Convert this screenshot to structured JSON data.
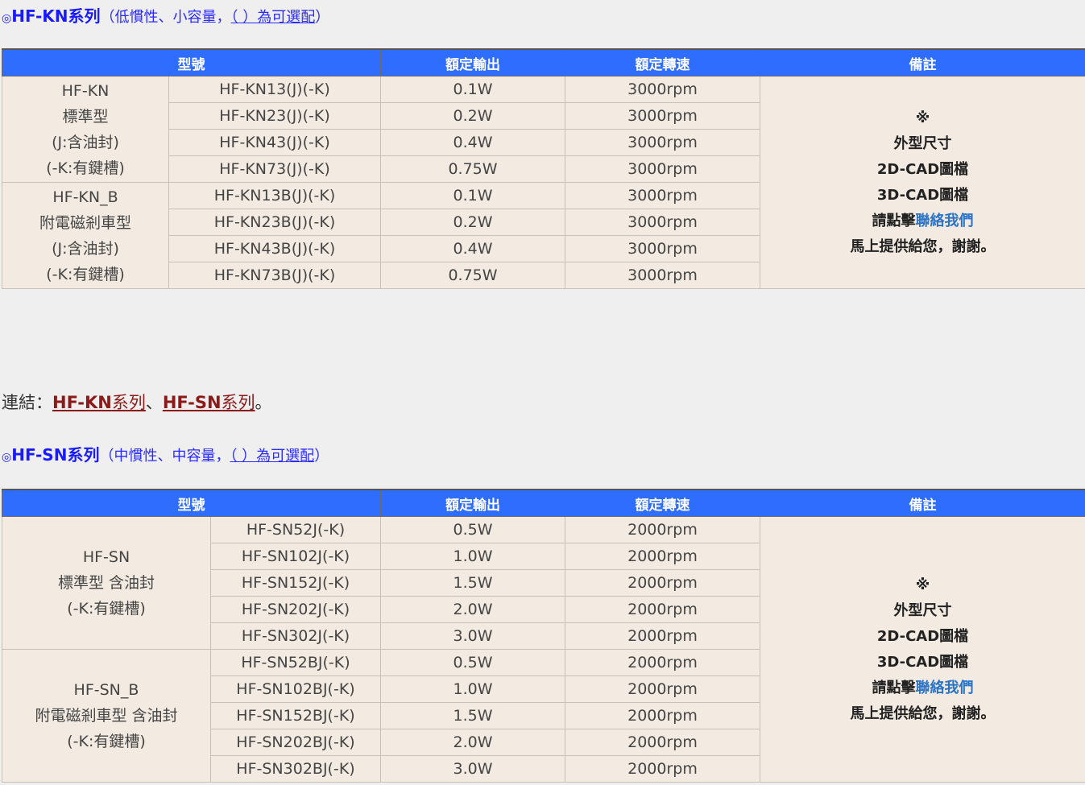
{
  "kn": {
    "heading": {
      "title": "HF-KN系列",
      "subtitle": "（低慣性、小容量，",
      "optional": "（ ）為可選配",
      "close": "）"
    },
    "headers": [
      "型號",
      "額定輸出",
      "額定轉速",
      "備註"
    ],
    "groups": [
      {
        "label_lines": [
          "HF-KN",
          "標準型",
          "(J:含油封)",
          "(-K:有鍵槽)"
        ],
        "rows": [
          {
            "model": "HF-KN13(J)(-K)",
            "output": "0.1W",
            "speed": "3000rpm"
          },
          {
            "model": "HF-KN23(J)(-K)",
            "output": "0.2W",
            "speed": "3000rpm"
          },
          {
            "model": "HF-KN43(J)(-K)",
            "output": "0.4W",
            "speed": "3000rpm"
          },
          {
            "model": "HF-KN73(J)(-K)",
            "output": "0.75W",
            "speed": "3000rpm"
          }
        ]
      },
      {
        "label_lines": [
          "HF-KN_B",
          "附電磁剎車型",
          "(J:含油封)",
          "(-K:有鍵槽)"
        ],
        "rows": [
          {
            "model": "HF-KN13B(J)(-K)",
            "output": "0.1W",
            "speed": "3000rpm"
          },
          {
            "model": "HF-KN23B(J)(-K)",
            "output": "0.2W",
            "speed": "3000rpm"
          },
          {
            "model": "HF-KN43B(J)(-K)",
            "output": "0.4W",
            "speed": "3000rpm"
          },
          {
            "model": "HF-KN73B(J)(-K)",
            "output": "0.75W",
            "speed": "3000rpm"
          }
        ]
      }
    ],
    "note": {
      "mark": "※",
      "line1": "外型尺寸",
      "line2": "2D-CAD圖檔",
      "line3": "3D-CAD圖檔",
      "click": "請點擊",
      "contact": "聯絡我們",
      "thanks": "馬上提供給您，謝謝。"
    }
  },
  "links": {
    "prefix": "連結：",
    "kn_code": "HF-KN",
    "kn_suffix": "系列",
    "sep": "、",
    "sn_code": "HF-SN",
    "sn_suffix": "系列",
    "end": "。"
  },
  "sn": {
    "heading": {
      "title": "HF-SN系列",
      "subtitle": "（中慣性、中容量，",
      "optional": "（ ）為可選配",
      "close": "）"
    },
    "headers": [
      "型號",
      "額定輸出",
      "額定轉速",
      "備註"
    ],
    "groups": [
      {
        "label_lines": [
          "HF-SN",
          "標準型 含油封",
          "(-K:有鍵槽)"
        ],
        "rows": [
          {
            "model": "HF-SN52J(-K)",
            "output": "0.5W",
            "speed": "2000rpm"
          },
          {
            "model": "HF-SN102J(-K)",
            "output": "1.0W",
            "speed": "2000rpm"
          },
          {
            "model": "HF-SN152J(-K)",
            "output": "1.5W",
            "speed": "2000rpm"
          },
          {
            "model": "HF-SN202J(-K)",
            "output": "2.0W",
            "speed": "2000rpm"
          },
          {
            "model": "HF-SN302J(-K)",
            "output": "3.0W",
            "speed": "2000rpm"
          }
        ]
      },
      {
        "label_lines": [
          "HF-SN_B",
          "附電磁剎車型 含油封",
          "(-K:有鍵槽)"
        ],
        "rows": [
          {
            "model": "HF-SN52BJ(-K)",
            "output": "0.5W",
            "speed": "2000rpm"
          },
          {
            "model": "HF-SN102BJ(-K)",
            "output": "1.0W",
            "speed": "2000rpm"
          },
          {
            "model": "HF-SN152BJ(-K)",
            "output": "1.5W",
            "speed": "2000rpm"
          },
          {
            "model": "HF-SN202BJ(-K)",
            "output": "2.0W",
            "speed": "2000rpm"
          },
          {
            "model": "HF-SN302BJ(-K)",
            "output": "3.0W",
            "speed": "2000rpm"
          }
        ]
      }
    ],
    "note": {
      "mark": "※",
      "line1": "外型尺寸",
      "line2": "2D-CAD圖檔",
      "line3": "3D-CAD圖檔",
      "click": "請點擊",
      "contact": "聯絡我們",
      "thanks": "馬上提供給您，謝謝。"
    }
  }
}
